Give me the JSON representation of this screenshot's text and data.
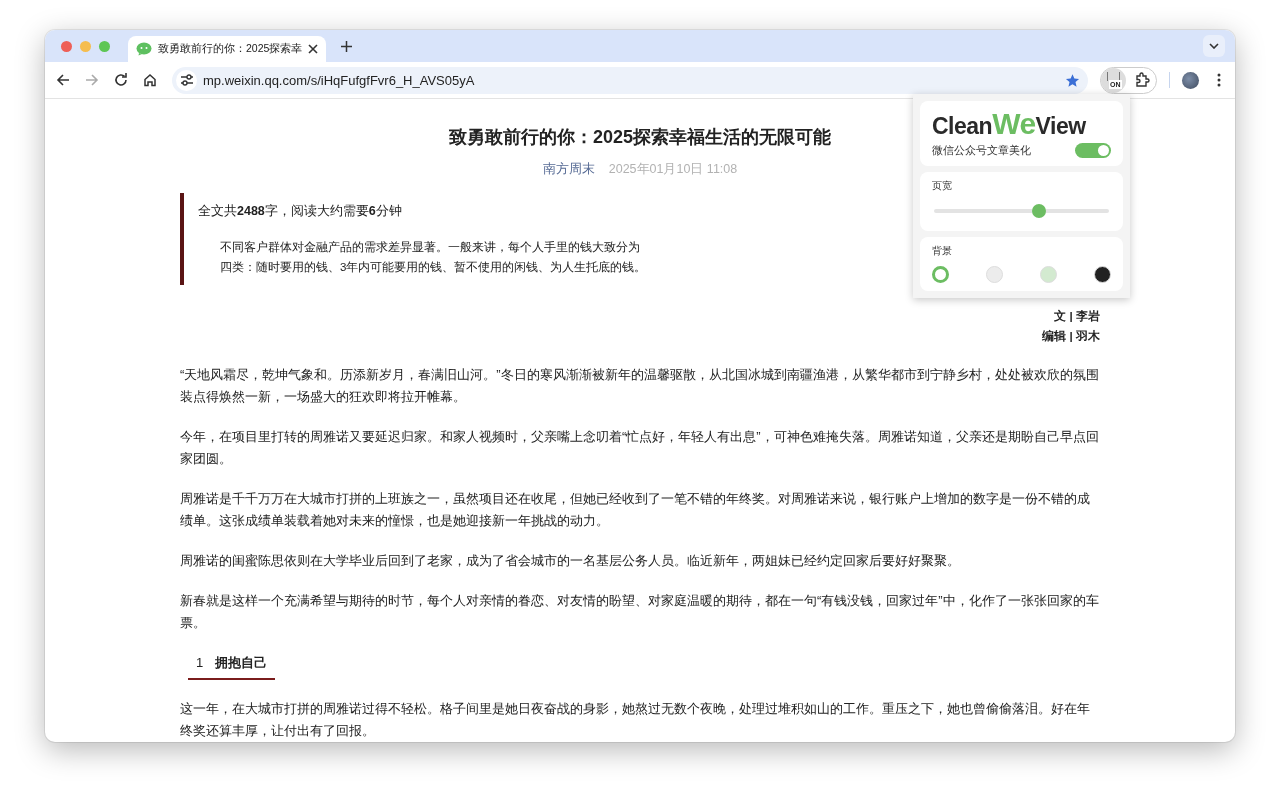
{
  "tab": {
    "title": "致勇敢前行的你：2025探索幸",
    "selected": true
  },
  "address_bar": {
    "url": "mp.weixin.qq.com/s/iHqFufgfFvr6_H_AVS05yA",
    "bookmarked": true
  },
  "extension": {
    "badge": "ON"
  },
  "popup": {
    "logo": {
      "before": "Clean",
      "highlight": "We",
      "after": "View"
    },
    "toggle": {
      "label": "微信公众号文章美化",
      "on": true
    },
    "width": {
      "label": "页宽",
      "level": 0.6
    },
    "background": {
      "label": "背景",
      "swatches": [
        {
          "color": "#ffffff",
          "selected": true
        },
        {
          "color": "#ececec",
          "selected": false
        },
        {
          "color": "#d3ead0",
          "selected": false
        },
        {
          "color": "#222222",
          "selected": false
        }
      ]
    }
  },
  "article": {
    "title": "致勇敢前行的你：2025探索幸福生活的无限可能",
    "source": "南方周末",
    "date": "2025年01月10日 11:08",
    "summary": {
      "heading": "全文共**2488**字，阅读大约需要**6**分钟",
      "text": "不同客户群体对金融产品的需求差异显著。一般来讲，每个人手里的钱大致分为四类：随时要用的钱、3年内可能要用的钱、暂不使用的闲钱、为人生托底的钱。"
    },
    "credits": [
      "文 | 李岩",
      "编辑 | 羽木"
    ],
    "blocks": [
      {
        "kind": "paragraph",
        "text": "“天地风霜尽，乾坤气象和。历添新岁月，春满旧山河。”冬日的寒风渐渐被新年的温馨驱散，从北国冰城到南疆渔港，从繁华都市到宁静乡村，处处被欢欣的氛围装点得焕然一新，一场盛大的狂欢即将拉开帷幕。"
      },
      {
        "kind": "paragraph",
        "text": "今年，在项目里打转的周雅诺又要延迟归家。和家人视频时，父亲嘴上念叨着“忙点好，年轻人有出息”，可神色难掩失落。周雅诺知道，父亲还是期盼自己早点回家团圆。"
      },
      {
        "kind": "paragraph",
        "text": "周雅诺是千千万万在大城市打拼的上班族之一，虽然项目还在收尾，但她已经收到了一笔不错的年终奖。对周雅诺来说，银行账户上增加的数字是一份不错的成绩单。这张成绩单装载着她对未来的憧憬，也是她迎接新一年挑战的动力。"
      },
      {
        "kind": "paragraph",
        "text": "周雅诺的闺蜜陈思依则在大学毕业后回到了老家，成为了省会城市的一名基层公务人员。临近新年，两姐妹已经约定回家后要好好聚聚。"
      },
      {
        "kind": "paragraph",
        "text": "新春就是这样一个充满希望与期待的时节，每个人对亲情的眷恋、对友情的盼望、对家庭温暖的期待，都在一句“有钱没钱，回家过年”中，化作了一张张回家的车票。"
      },
      {
        "kind": "heading",
        "number": "1",
        "text": "拥抱自己"
      },
      {
        "kind": "paragraph",
        "text": "这一年，在大城市打拼的周雅诺过得不轻松。格子间里是她日夜奋战的身影，她熬过无数个夜晚，处理过堆积如山的工作。重压之下，她也曾偷偷落泪。好在年终奖还算丰厚，让付出有了回报。"
      }
    ]
  }
}
